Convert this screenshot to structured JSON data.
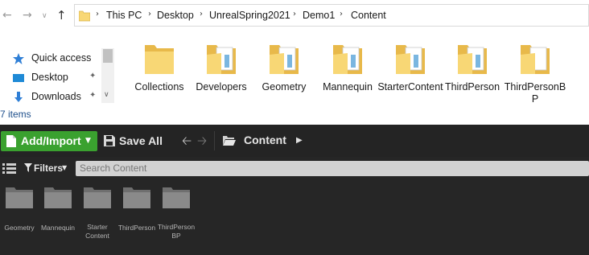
{
  "explorer": {
    "breadcrumbs": [
      "This PC",
      "Desktop",
      "UnrealSpring2021",
      "Demo1",
      "Content"
    ],
    "nav_items": [
      {
        "label": "Quick access",
        "icon": "star-icon"
      },
      {
        "label": "Desktop",
        "icon": "desktop-icon",
        "pinned": true
      },
      {
        "label": "Downloads",
        "icon": "download-arrow-icon",
        "pinned": true
      }
    ],
    "item_count": "7 items",
    "folders": [
      {
        "name": "Collections"
      },
      {
        "name": "Developers"
      },
      {
        "name": "Geometry"
      },
      {
        "name": "Mannequin"
      },
      {
        "name": "StarterContent"
      },
      {
        "name": "ThirdPerson"
      },
      {
        "name": "ThirdPersonBP"
      }
    ]
  },
  "content_browser": {
    "add_import_label": "Add/Import",
    "save_all_label": "Save All",
    "path_label": "Content",
    "filters_label": "Filters",
    "search_placeholder": "Search Content",
    "assets": [
      {
        "line1": "Geometry",
        "line2": ""
      },
      {
        "line1": "Mannequin",
        "line2": ""
      },
      {
        "line1": "Starter",
        "line2": "Content"
      },
      {
        "line1": "ThirdPerson",
        "line2": ""
      },
      {
        "line1": "ThirdPerson",
        "line2": "BP"
      }
    ]
  },
  "colors": {
    "folder_yellow": "#f8d775",
    "add_import_green": "#3aa12f",
    "ue_background": "#262626",
    "ue_folder_grey": "#8a8a8a"
  }
}
